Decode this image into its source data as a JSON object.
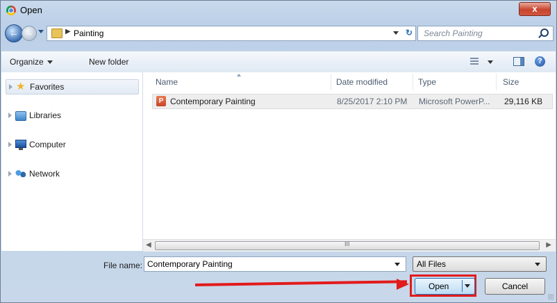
{
  "window": {
    "title": "Open",
    "close_glyph": "x"
  },
  "navigation": {
    "back_glyph": "←",
    "forward_glyph": "→",
    "breadcrumb": [
      "Painting"
    ],
    "refresh_glyph": "↻",
    "search_placeholder": "Search Painting"
  },
  "toolbar": {
    "organize_label": "Organize",
    "new_folder_label": "New folder",
    "help_glyph": "?"
  },
  "sidebar": {
    "items": [
      {
        "label": "Favorites",
        "icon": "star-icon",
        "selected": true
      },
      {
        "label": "Libraries",
        "icon": "library-icon",
        "selected": false
      },
      {
        "label": "Computer",
        "icon": "computer-icon",
        "selected": false
      },
      {
        "label": "Network",
        "icon": "network-icon",
        "selected": false
      }
    ]
  },
  "file_list": {
    "columns": [
      "Name",
      "Date modified",
      "Type",
      "Size"
    ],
    "rows": [
      {
        "name": "Contemporary Painting",
        "date_modified": "8/25/2017 2:10 PM",
        "type": "Microsoft PowerP...",
        "size": "29,116 KB",
        "icon": "powerpoint-file-icon",
        "icon_letter": "P"
      }
    ]
  },
  "scrollbar": {
    "left_glyph": "◀",
    "right_glyph": "▶",
    "grip": "III"
  },
  "footer": {
    "file_name_label": "File name:",
    "file_name_value": "Contemporary Painting",
    "file_type_value": "All Files",
    "open_label": "Open",
    "cancel_label": "Cancel"
  },
  "colors": {
    "annotation_red": "#e21b1b",
    "accent_blue": "#2d6fb3"
  }
}
